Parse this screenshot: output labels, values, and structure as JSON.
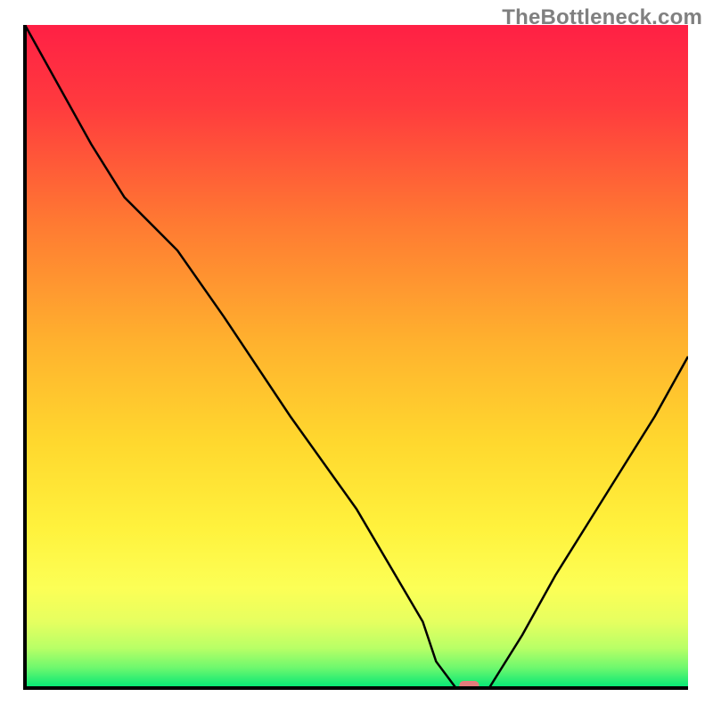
{
  "watermark": "TheBottleneck.com",
  "colors": {
    "gradient_top": "#ff2045",
    "gradient_mid1": "#ff8a2a",
    "gradient_mid2": "#ffde32",
    "gradient_yellow": "#fff84c",
    "gradient_green": "#00e676",
    "axis": "#000000",
    "marker": "#e47c7c"
  },
  "chart_data": {
    "type": "line",
    "title": "",
    "xlabel": "",
    "ylabel": "",
    "xlim": [
      0,
      100
    ],
    "ylim": [
      0,
      100
    ],
    "x": [
      0,
      5,
      10,
      15,
      20,
      23,
      30,
      40,
      50,
      60,
      62,
      65,
      67,
      70,
      75,
      80,
      85,
      90,
      95,
      100
    ],
    "values": [
      100,
      91,
      82,
      74,
      69,
      66,
      56,
      41,
      27,
      10,
      4,
      0,
      0,
      0,
      8,
      17,
      25,
      33,
      41,
      50
    ],
    "marker": {
      "x": 67,
      "y": 0,
      "width_x": 3,
      "height_y": 1.2
    },
    "annotations": []
  }
}
